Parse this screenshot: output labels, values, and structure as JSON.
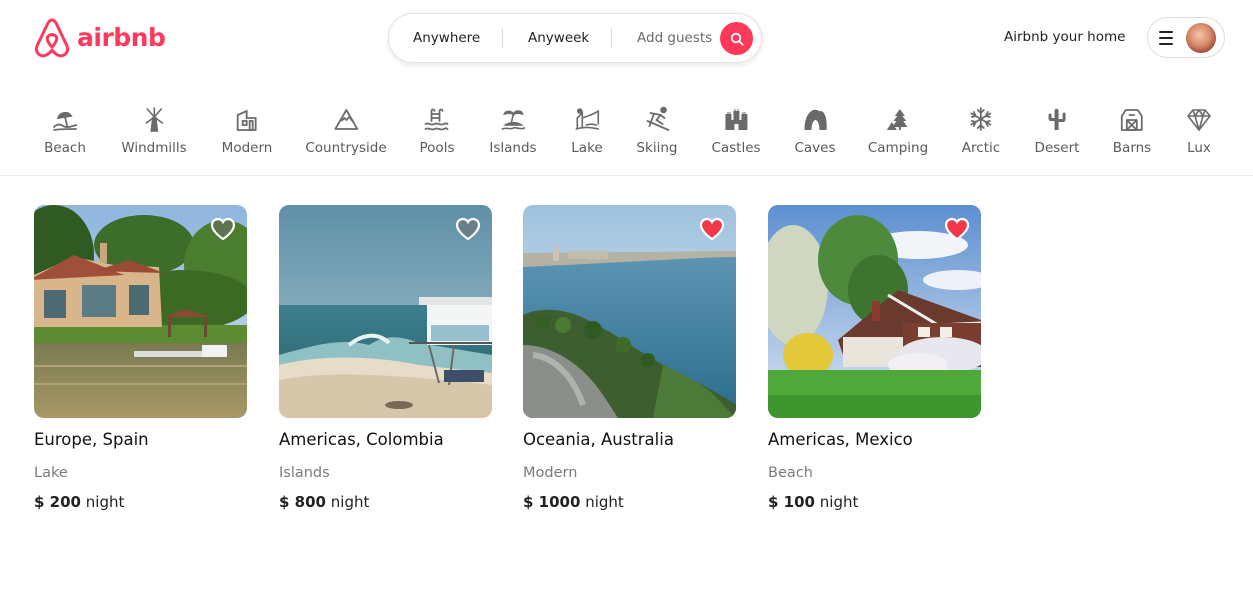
{
  "brand": {
    "name": "airbnb",
    "color": "#FF385C",
    "icon": "airbnb-logo-icon"
  },
  "search": {
    "anywhere": "Anywhere",
    "anyweek": "Anyweek",
    "guests": "Add guests",
    "icon": "search-icon"
  },
  "header": {
    "host_link": "Airbnb your home",
    "menu_icon": "hamburger-icon",
    "avatar": "user-avatar"
  },
  "categories": [
    {
      "label": "Beach",
      "icon": "beach-icon"
    },
    {
      "label": "Windmills",
      "icon": "windmill-icon"
    },
    {
      "label": "Modern",
      "icon": "modern-house-icon"
    },
    {
      "label": "Countryside",
      "icon": "countryside-icon"
    },
    {
      "label": "Pools",
      "icon": "pool-icon"
    },
    {
      "label": "Islands",
      "icon": "island-icon"
    },
    {
      "label": "Lake",
      "icon": "lake-icon"
    },
    {
      "label": "Skiing",
      "icon": "skiing-icon"
    },
    {
      "label": "Castles",
      "icon": "castle-icon"
    },
    {
      "label": "Caves",
      "icon": "cave-icon"
    },
    {
      "label": "Camping",
      "icon": "camping-icon"
    },
    {
      "label": "Arctic",
      "icon": "snowflake-icon"
    },
    {
      "label": "Desert",
      "icon": "cactus-icon"
    },
    {
      "label": "Barns",
      "icon": "barn-icon"
    },
    {
      "label": "Lux",
      "icon": "diamond-icon"
    }
  ],
  "listings": [
    {
      "location": "Europe, Spain",
      "category": "Lake",
      "price": "$ 200",
      "unit": "night",
      "favorited": false,
      "image": "lakeside-villa-photo"
    },
    {
      "location": "Americas, Colombia",
      "category": "Islands",
      "price": "$ 800",
      "unit": "night",
      "favorited": false,
      "image": "beach-house-waves-photo"
    },
    {
      "location": "Oceania, Australia",
      "category": "Modern",
      "price": "$ 1000",
      "unit": "night",
      "favorited": true,
      "image": "coastal-bay-photo"
    },
    {
      "location": "Americas, Mexico",
      "category": "Beach",
      "price": "$ 100",
      "unit": "night",
      "favorited": true,
      "image": "cottage-garden-photo"
    }
  ],
  "colors": {
    "accent": "#FF385C",
    "heart_active": "#F0384A",
    "heart_inactive": "#6B6B6B"
  }
}
